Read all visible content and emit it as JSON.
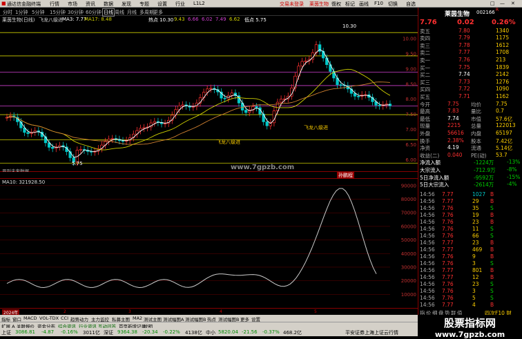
{
  "menubar": {
    "app_title": "通达信金融终端",
    "items": [
      "行情",
      "市场",
      "资讯",
      "数据",
      "发现",
      "专题",
      "设置",
      "行业",
      "L1L2"
    ],
    "trade_login": "交易未登录",
    "stock_name": "莱茵生物",
    "right_items": [
      "復权",
      "标记",
      "画线",
      "F10",
      "切换",
      "自选"
    ],
    "window_buttons": [
      "□",
      "—",
      "✕"
    ]
  },
  "periods": [
    "分时",
    "1分钟",
    "5分钟",
    "15分钟",
    "30分钟",
    "60分钟",
    "日线",
    "周线",
    "月线",
    "多周期",
    "更多"
  ],
  "chart_info": {
    "title": "莱茵生物(日线)",
    "subtitle": "飞龙八级进",
    "ma3": "MA3: 7.77",
    "ma17": "MA17: 8.48",
    "hot": "热点 10.30",
    "v1": "9.43",
    "v2": "6.66",
    "v3": "6.02",
    "v4": "7.49",
    "v5": "6.62",
    "low": "低点 5.75"
  },
  "main_chart": {
    "high_label": "10.30",
    "low_label": "5.75",
    "annot1": "飞龙八级进",
    "annot2": "飞龙八级进",
    "corner_text": "周到未来数据",
    "y_ticks": [
      "10.00",
      "9.50",
      "9.00",
      "8.50",
      "8.00",
      "7.50",
      "7.00",
      "6.50",
      "6.00"
    ],
    "hlines": [
      {
        "value": 10.2,
        "color": "#d0d000"
      },
      {
        "value": 9.43,
        "color": "#d0d000"
      },
      {
        "value": 8.89,
        "color": "#d040d0"
      },
      {
        "value": 8.45,
        "color": "#d040d0"
      },
      {
        "value": 7.78,
        "color": "#d040d0"
      },
      {
        "value": 7.49,
        "color": "#d0d000"
      },
      {
        "value": 6.66,
        "color": "#d0d000"
      },
      {
        "value": 5.89,
        "color": "#d0d000"
      }
    ]
  },
  "separator": {
    "label": "孙鹏程"
  },
  "lower_chart": {
    "title": "MA10: 321928.50",
    "y_ticks": [
      "90000",
      "80000",
      "70000",
      "60000",
      "50000",
      "40000",
      "30000",
      "20000",
      "10000"
    ]
  },
  "datebar": {
    "year": "2024年",
    "marks": [
      "2",
      "3",
      "4",
      "5"
    ]
  },
  "tabs1": [
    "指标",
    "窗口",
    "MACD",
    "VOL-TDX",
    "CCI",
    "趋势动力",
    "主力监控",
    "私募主图",
    "MA2",
    "测试主图",
    "测试幅图A",
    "测试幅图B",
    "热点",
    "测试幅图B",
    "更多",
    "设置"
  ],
  "tabs2": [
    "扩展 A",
    "关联报价",
    "资金分布",
    "综合资讯",
    "行业资讯",
    "互动问答",
    "首页新增记录",
    "说明"
  ],
  "watermark": "www.7gpzb.com",
  "status": {
    "sh_label": "上证",
    "sh_val": "3086.81",
    "sh_chg": "-4.87",
    "sh_pct": "-0.16%",
    "sh_amt": "3011亿",
    "sz_label": "深证",
    "sz_val": "9364.38",
    "sz_chg": "-20.34",
    "sz_pct": "-0.22%",
    "sz_amt": "4138亿",
    "zx_label": "中小",
    "zx_val": "5820.04",
    "zx_chg": "-21.56",
    "zx_pct": "-0.37%",
    "zx_amt": "468.2亿",
    "broker": "平安证券上海上证云行情"
  },
  "quote": {
    "name": "莱茵生物",
    "code": "002166",
    "flag": "R",
    "price": "7.76",
    "change": "0.02",
    "pct": "0.26%",
    "asks": [
      {
        "label": "卖五",
        "price": "7.80",
        "vol": "1340"
      },
      {
        "label": "卖四",
        "price": "7.79",
        "vol": "1175"
      },
      {
        "label": "卖三",
        "price": "7.78",
        "vol": "1612"
      },
      {
        "label": "卖二",
        "price": "7.77",
        "vol": "1708"
      },
      {
        "label": "卖一",
        "price": "7.76",
        "vol": "213"
      }
    ],
    "bids": [
      {
        "label": "买一",
        "price": "7.75",
        "vol": "1839"
      },
      {
        "label": "买二",
        "price": "7.74",
        "vol": "2142"
      },
      {
        "label": "买三",
        "price": "7.73",
        "vol": "1276"
      },
      {
        "label": "买四",
        "price": "7.72",
        "vol": "1090"
      },
      {
        "label": "买五",
        "price": "7.71",
        "vol": "1162"
      }
    ],
    "stats": [
      {
        "l1": "今开",
        "v1": "7.75",
        "l2": "均价",
        "v2": "7.75"
      },
      {
        "l1": "最高",
        "v1": "7.83",
        "l2": "量比",
        "v2": "0.7"
      },
      {
        "l1": "最低",
        "v1": "7.74",
        "l2": "市值",
        "v2": "57.6亿"
      },
      {
        "l1": "现量",
        "v1": "2215",
        "l2": "总量",
        "v2": "122013"
      },
      {
        "l1": "外盘",
        "v1": "56616",
        "l2": "内盘",
        "v2": "65197"
      },
      {
        "l1": "换手",
        "v1": "2.38%",
        "l2": "股本",
        "v2": "7.42亿"
      },
      {
        "l1": "净资",
        "v1": "4.19",
        "l2": "流通",
        "v2": "5.14亿"
      },
      {
        "l1": "收益(二)",
        "v1": "0.040",
        "l2": "PE(动)",
        "v2": "53.7"
      }
    ],
    "flows": [
      {
        "label": "净流入额",
        "value": "-1224万",
        "pct": "-13%"
      },
      {
        "label": "大宗流入",
        "value": "-712.9万",
        "pct": "-8%"
      },
      {
        "label": "5日净流入额",
        "value": "-9592万",
        "pct": "-15%"
      },
      {
        "label": "5日大宗流入",
        "value": "-2614万",
        "pct": "-4%"
      }
    ],
    "ticks": [
      {
        "t": "14:56",
        "p": "7.77",
        "v": "1027",
        "d": "B"
      },
      {
        "t": "14:56",
        "p": "7.77",
        "v": "29",
        "d": "B"
      },
      {
        "t": "14:56",
        "p": "7.76",
        "v": "35",
        "d": "S"
      },
      {
        "t": "14:56",
        "p": "7.76",
        "v": "19",
        "d": "B"
      },
      {
        "t": "14:56",
        "p": "7.76",
        "v": "23",
        "d": "B"
      },
      {
        "t": "14:56",
        "p": "7.76",
        "v": "11",
        "d": "S"
      },
      {
        "t": "14:56",
        "p": "7.76",
        "v": "66",
        "d": "S"
      },
      {
        "t": "14:56",
        "p": "7.77",
        "v": "23",
        "d": "B"
      },
      {
        "t": "14:56",
        "p": "7.77",
        "v": "469",
        "d": "B"
      },
      {
        "t": "14:56",
        "p": "7.76",
        "v": "9",
        "d": "B"
      },
      {
        "t": "14:56",
        "p": "7.76",
        "v": "3",
        "d": "S"
      },
      {
        "t": "14:56",
        "p": "7.77",
        "v": "801",
        "d": "B"
      },
      {
        "t": "14:56",
        "p": "7.77",
        "v": "12",
        "d": "B"
      },
      {
        "t": "14:56",
        "p": "7.76",
        "v": "23",
        "d": "S"
      },
      {
        "t": "14:56",
        "p": "7.76",
        "v": "3",
        "d": "S"
      },
      {
        "t": "14:56",
        "p": "7.76",
        "v": "5",
        "d": "S"
      },
      {
        "t": "14:56",
        "p": "7.77",
        "v": "4",
        "d": "B"
      }
    ],
    "footer_tabs": [
      "指",
      "价",
      "细",
      "盘",
      "势",
      "联",
      "值"
    ],
    "footer_right": "四次F10 财"
  },
  "brand": {
    "line1": "股票指标网",
    "line2": "www.7gpzb.com"
  },
  "colors": {
    "up": "#ff3030",
    "down": "#00c8c8",
    "ma_yellow": "#d0d000",
    "ma_white": "#ffffff",
    "ma_orange": "#d08030"
  }
}
